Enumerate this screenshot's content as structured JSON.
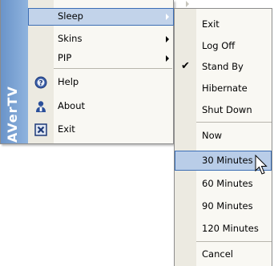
{
  "app": {
    "brand": "AVerTV"
  },
  "main_menu": {
    "items": [
      {
        "label": "Sleep",
        "submenu": true,
        "highlighted": true,
        "icon": ""
      },
      {
        "label": "Skins",
        "submenu": true,
        "highlighted": false,
        "icon": ""
      },
      {
        "label": "PIP",
        "submenu": true,
        "highlighted": false,
        "icon": ""
      },
      {
        "label": "Help",
        "submenu": false,
        "highlighted": false,
        "icon": "help-icon"
      },
      {
        "label": "About",
        "submenu": false,
        "highlighted": false,
        "icon": "user-icon"
      },
      {
        "label": "Exit",
        "submenu": false,
        "highlighted": false,
        "icon": "close-box-icon"
      }
    ]
  },
  "sleep_menu": {
    "items": [
      {
        "label": "Exit",
        "checked": false,
        "highlighted": false
      },
      {
        "label": "Log Off",
        "checked": false,
        "highlighted": false
      },
      {
        "label": "Stand By",
        "checked": true,
        "highlighted": false
      },
      {
        "label": "Hibernate",
        "checked": false,
        "highlighted": false
      },
      {
        "label": "Shut Down",
        "checked": false,
        "highlighted": false
      },
      {
        "label": "Now",
        "checked": false,
        "highlighted": false
      },
      {
        "label": "30 Minutes",
        "checked": false,
        "highlighted": true
      },
      {
        "label": "60 Minutes",
        "checked": false,
        "highlighted": false
      },
      {
        "label": "90 Minutes",
        "checked": false,
        "highlighted": false
      },
      {
        "label": "120 Minutes",
        "checked": false,
        "highlighted": false
      },
      {
        "label": "Cancel",
        "checked": false,
        "highlighted": false
      }
    ]
  },
  "colors": {
    "highlight_fill": "#c2d3ea",
    "highlight_border": "#3c6eb4",
    "banner": "#7ba3d6",
    "menu_bg": "#f9f8f3"
  }
}
